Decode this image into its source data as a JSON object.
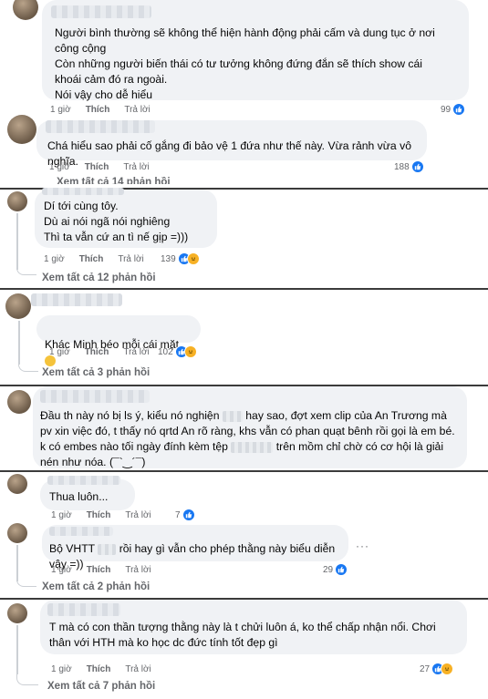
{
  "comments": [
    {
      "text": "Người bình thường sẽ không thể hiện hành động phải cấm và dung tục ở nơi công cộng\nCòn những người biến thái có tư tưởng không đứng đắn sẽ thích show cái khoái cảm đó ra ngoài.\nNói vậy cho dễ hiểu",
      "time": "1 giờ",
      "like": "Thích",
      "reply": "Trả lời",
      "reactions": "99"
    },
    {
      "text": "Chá hiểu sao phải cố gắng đi bảo vệ 1 đứa như thế này. Vừa rảnh vừa vô nghĩa.",
      "time": "1 giờ",
      "like": "Thích",
      "reply": "Trả lời",
      "reactions": "188",
      "view_all": "Xem tất cả 14 phản hồi"
    },
    {
      "text": "Dí tới cùng tôy.\nDù ai nói ngã nói nghiêng\nThì ta vẫn cứ an tì nế gịp =)))",
      "time": "1 giờ",
      "like": "Thích",
      "reply": "Trả lời",
      "reactions": "139",
      "view_all": "Xem tất cả 12 phản hồi"
    },
    {
      "text": "Khác Minh béo mỗi cái mặt",
      "time": "1 giờ",
      "like": "Thích",
      "reply": "Trả lời",
      "reactions": "102",
      "view_all": "Xem tất cả 3 phản hồi"
    },
    {
      "text_parts": [
        "Đầu th này nó bị ls ý, kiểu nó nghiện",
        "hay sao, đợt xem clip của An Trương mà pv xin việc đó, t thấy nó qrtd An rõ ràng, khs vẫn có phan quạt bênh rồi gọi là em bé. k có embes nào tối ngày đính kèm tệp",
        "trên mồm chỉ chờ có cơ hội là giải nén như nóa.",
        "(¯`‿´¯)"
      ]
    },
    {
      "text": "Thua luôn...",
      "time": "1 giờ",
      "like": "Thích",
      "reply": "Trả lời",
      "reactions": "7"
    },
    {
      "text_parts": [
        "Bộ VHTT",
        "rồi hay gì vẫn cho phép thằng này biểu diễn vậy =))"
      ],
      "time": "1 giờ",
      "like": "Thích",
      "reply": "Trả lời",
      "reactions": "29",
      "more": "···",
      "view_all": "Xem tất cả 2 phản hồi"
    },
    {
      "text": "T mà có con thần tượng thằng này là t chửi luôn á, ko thể chấp nhận nổi. Chơi thân với HTH mà ko học dc đức tính tốt đẹp gì",
      "time": "1 giờ",
      "like": "Thích",
      "reply": "Trả lời",
      "reactions": "27",
      "view_all": "Xem tất cả 7 phản hồi"
    }
  ]
}
